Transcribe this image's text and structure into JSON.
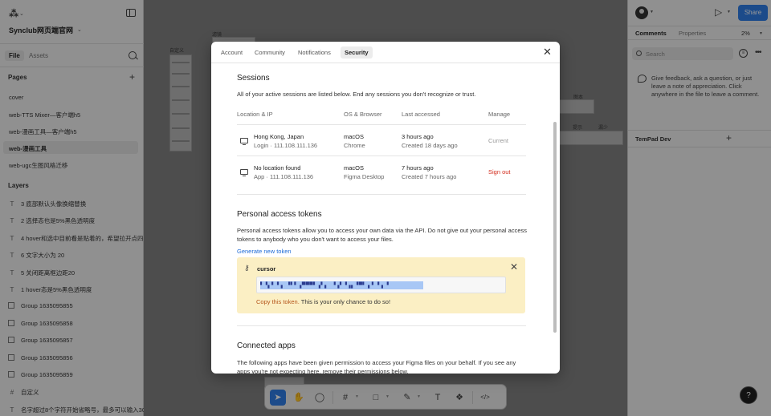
{
  "left_panel": {
    "project_name": "Synclub网页端官网",
    "tabs": {
      "file": "File",
      "assets": "Assets"
    },
    "pages_heading": "Pages",
    "pages": [
      {
        "label": "cover",
        "active": false
      },
      {
        "label": "web-TTS Mixer—客户端h5",
        "active": false
      },
      {
        "label": "web-漫画工具—客户端h5",
        "active": false
      },
      {
        "label": "web-漫画工具",
        "active": true
      },
      {
        "label": "web-ugc生图风格迁移",
        "active": false
      }
    ],
    "layers_heading": "Layers",
    "layers": [
      {
        "icon": "text",
        "label": "3 底部默认头像换缩替换"
      },
      {
        "icon": "text",
        "label": "2 选择态也是5%黑色透明度"
      },
      {
        "icon": "text",
        "label": "4 hover和选中目前看是贴着的，希望拉开点四"
      },
      {
        "icon": "text",
        "label": "6 文字大小为 20"
      },
      {
        "icon": "text",
        "label": "5 关闭距离框边距20"
      },
      {
        "icon": "text",
        "label": "1 hover态是5%黑色透明度"
      },
      {
        "icon": "frame",
        "label": "Group 1635095855"
      },
      {
        "icon": "frame",
        "label": "Group 1635095858"
      },
      {
        "icon": "frame",
        "label": "Group 1635095857"
      },
      {
        "icon": "frame",
        "label": "Group 1635095856"
      },
      {
        "icon": "frame",
        "label": "Group 1635095859"
      },
      {
        "icon": "hash",
        "label": "自定义"
      },
      {
        "icon": "text",
        "label": "名字超过8个字符开始省略号，最多可以输入30"
      }
    ]
  },
  "canvas": {
    "labels": [
      "自定义",
      "滤镜",
      "图本",
      "提示",
      "漏少"
    ]
  },
  "toolbar": {
    "tools": [
      {
        "name": "move-tool",
        "glyph": "➤",
        "selected": true
      },
      {
        "name": "hand-tool",
        "glyph": "✋",
        "selected": false
      },
      {
        "name": "comment-tool",
        "glyph": "◯",
        "selected": false
      },
      {
        "name": "frame-tool",
        "glyph": "#",
        "selected": false
      },
      {
        "name": "shape-tool",
        "glyph": "□",
        "selected": false
      },
      {
        "name": "pen-tool",
        "glyph": "✎",
        "selected": false
      },
      {
        "name": "text-tool",
        "glyph": "T",
        "selected": false
      },
      {
        "name": "components-tool",
        "glyph": "❖",
        "selected": false
      },
      {
        "name": "dev-mode-tool",
        "glyph": "</>",
        "selected": false
      }
    ]
  },
  "right_panel": {
    "share_label": "Share",
    "tabs": {
      "comments": "Comments",
      "properties": "Properties"
    },
    "zoom": "2%",
    "search_placeholder": "Search",
    "feedback_text": "Give feedback, ask a question, or just leave a note of appreciation. Click anywhere in the file to leave a comment.",
    "plugin_name": "TemPad Dev",
    "help_label": "?"
  },
  "modal": {
    "tabs": [
      {
        "label": "Account",
        "selected": false
      },
      {
        "label": "Community",
        "selected": false
      },
      {
        "label": "Notifications",
        "selected": false
      },
      {
        "label": "Security",
        "selected": true
      }
    ],
    "sessions": {
      "title": "Sessions",
      "description": "All of your active sessions are listed below. End any sessions you don't recognize or trust.",
      "columns": [
        "Location & IP",
        "OS & Browser",
        "Last accessed",
        "Manage"
      ],
      "rows": [
        {
          "location": "Hong Kong, Japan",
          "ip": "Login · 111.108.111.136",
          "os": "macOS",
          "browser": "Chrome",
          "last": "3 hours ago",
          "created": "Created 18 days ago",
          "manage": "Current"
        },
        {
          "location": "No location found",
          "ip": "App · 111.108.111.136",
          "os": "macOS",
          "browser": "Figma Desktop",
          "last": "7 hours ago",
          "created": "Created 7 hours ago",
          "manage": "Sign out"
        }
      ]
    },
    "tokens": {
      "title": "Personal access tokens",
      "description": "Personal access tokens allow you to access your own data via the API. Do not give out your personal access tokens to anybody who you don't want to access your files.",
      "generate_label": "Generate new token",
      "token_name": "cursor",
      "token_value": "▘▝▖▘▝▗ ▝▘▘▗▀▀▀▘▗▘▖ ▝▗▘▝▗▖▝▀▘▗▝ ▘▖▝",
      "copy_label": "Copy this token.",
      "warning": "This is your only chance to do so!"
    },
    "apps": {
      "title": "Connected apps",
      "description": "The following apps have been given permission to access your Figma files on your behalf. If you see any apps you're not expecting here, remove their permissions below."
    }
  }
}
